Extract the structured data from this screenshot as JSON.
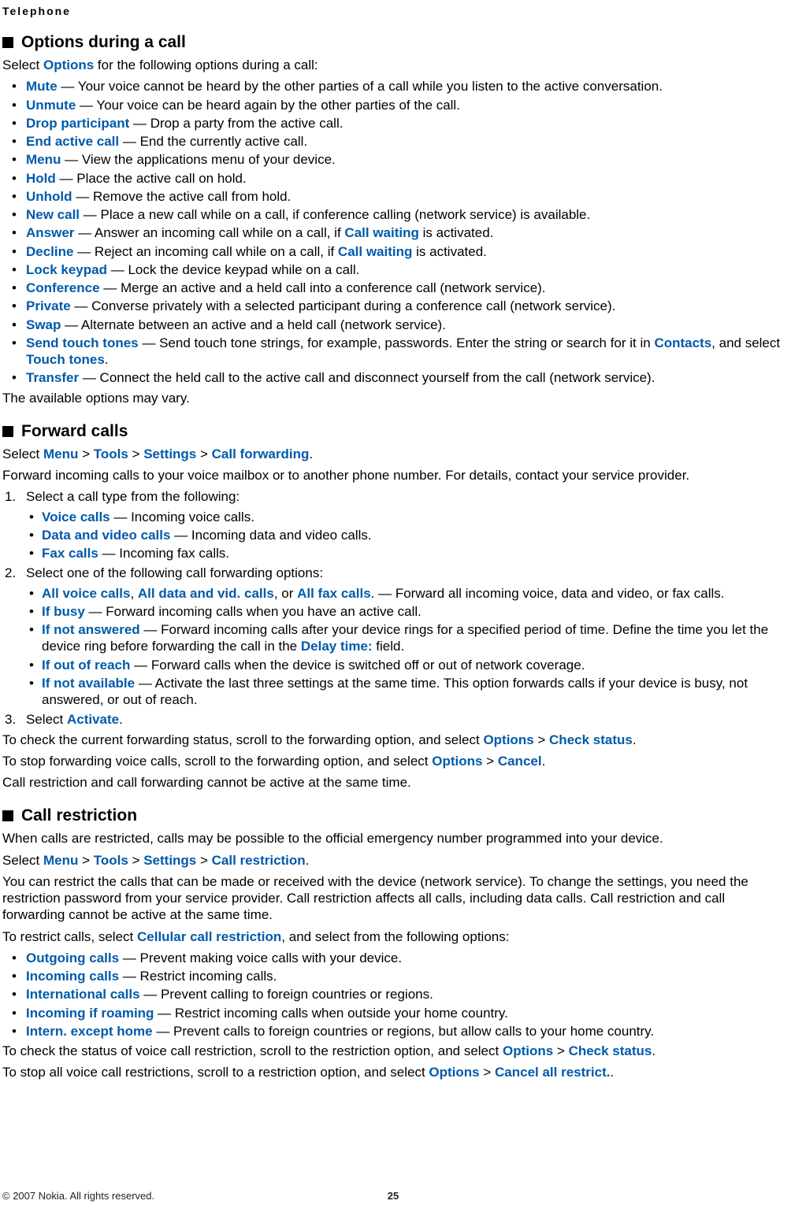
{
  "running_head": "Telephone",
  "s1": {
    "title": "Options during a call",
    "intro_pre": "Select ",
    "intro_key": "Options",
    "intro_post": " for the following options during a call:",
    "items": [
      {
        "key": "Mute",
        "rest": " — Your voice cannot be heard by the other parties of a call while you listen to the active conversation."
      },
      {
        "key": "Unmute",
        "rest": " — Your voice can be heard again by the other parties of the call."
      },
      {
        "key": "Drop participant",
        "rest": " — Drop a party from the active call."
      },
      {
        "key": "End active call",
        "rest": " — End the currently active call."
      },
      {
        "key": "Menu",
        "rest": " — View the applications menu of your device."
      },
      {
        "key": "Hold",
        "rest": " — Place the active call on hold."
      },
      {
        "key": "Unhold",
        "rest": " — Remove the active call from hold."
      },
      {
        "key": "New call",
        "rest": " — Place a new call while on a call, if conference calling (network service) is available."
      },
      {
        "key": "Answer",
        "pre": " — Answer an incoming call while on a call, if ",
        "key2": "Call waiting",
        "post": " is activated."
      },
      {
        "key": "Decline",
        "pre": " — Reject an incoming call while on a call, if ",
        "key2": "Call waiting",
        "post": " is activated."
      },
      {
        "key": "Lock keypad",
        "rest": " — Lock the device keypad while on a call."
      },
      {
        "key": "Conference",
        "rest": " — Merge an active and a held call into a conference call (network service)."
      },
      {
        "key": "Private",
        "rest": " — Converse privately with a selected participant during a conference call (network service)."
      },
      {
        "key": "Swap",
        "rest": " — Alternate between an active and a held call (network service)."
      },
      {
        "key": "Send touch tones",
        "pre": " — Send touch tone strings, for example, passwords. Enter the string or search for it in ",
        "key2": "Contacts",
        "mid": ", and select ",
        "key3": "Touch tones",
        "post": "."
      },
      {
        "key": "Transfer",
        "rest": " — Connect the held call to the active call and disconnect yourself from the call (network service)."
      }
    ],
    "outro": "The available options may vary."
  },
  "s2": {
    "title": "Forward calls",
    "path": [
      "Menu",
      "Tools",
      "Settings",
      "Call forwarding"
    ],
    "path_prefix": "Select ",
    "sep": " > ",
    "path_end": ".",
    "intro": "Forward incoming calls to your voice mailbox or to another phone number. For details, contact your service provider.",
    "step1": "Select a call type from the following:",
    "step1_items": [
      {
        "key": "Voice calls",
        "rest": " — Incoming voice calls."
      },
      {
        "key": "Data and video calls",
        "rest": " — Incoming data and video calls."
      },
      {
        "key": "Fax calls",
        "rest": " — Incoming fax calls."
      }
    ],
    "step2": "Select one of the following call forwarding options:",
    "step2_item1": {
      "k1": "All voice calls",
      "c1": ", ",
      "k2": "All data and vid. calls",
      "c2": ", or ",
      "k3": "All fax calls",
      "c3": ". — Forward all incoming voice, data and video, or fax calls."
    },
    "step2_items_simple": [
      {
        "key": "If busy",
        "rest": " — Forward incoming calls when you have an active call."
      }
    ],
    "step2_item_delay": {
      "key": "If not answered",
      "pre": " — Forward incoming calls after your device rings for a specified period of time. Define the time you let the device ring before forwarding the call in the ",
      "key2": "Delay time:",
      "post": " field."
    },
    "step2_items_simple2": [
      {
        "key": "If out of reach",
        "rest": " —  Forward calls when the device is switched off or out of network coverage."
      },
      {
        "key": "If not available",
        "rest": " — Activate the last three settings at the same time. This option forwards calls if your device is busy, not answered, or out of reach."
      }
    ],
    "step3_pre": "Select ",
    "step3_key": "Activate",
    "step3_post": ".",
    "status_line": {
      "pre": "To check the current forwarding status, scroll to the forwarding option, and select ",
      "k1": "Options",
      "sep": " > ",
      "k2": "Check status",
      "post": "."
    },
    "cancel_line": {
      "pre": "To stop forwarding voice calls, scroll to the forwarding option, and select ",
      "k1": "Options",
      "sep": " > ",
      "k2": "Cancel",
      "post": "."
    },
    "tail": "Call restriction and call forwarding cannot be active at the same time."
  },
  "s3": {
    "title": "Call restriction",
    "intro": "When calls are restricted, calls may be possible to the official emergency number programmed into your device.",
    "path_prefix": "Select ",
    "path": [
      "Menu",
      "Tools",
      "Settings",
      "Call restriction"
    ],
    "sep": " > ",
    "path_end": ".",
    "desc": "You can restrict the calls that can be made or received with the device (network service). To change the settings, you need the restriction password from your service provider. Call restriction affects all calls, including data calls. Call restriction and call forwarding cannot be active at the same time.",
    "lead_pre": "To restrict calls, select ",
    "lead_key": "Cellular call restriction",
    "lead_post": ", and select from the following options:",
    "items": [
      {
        "key": "Outgoing calls",
        "rest": " — Prevent making voice calls with your device."
      },
      {
        "key": "Incoming calls",
        "rest": " — Restrict incoming calls."
      },
      {
        "key": "International calls",
        "rest": " — Prevent calling to foreign countries or regions."
      },
      {
        "key": "Incoming if roaming",
        "rest": " — Restrict incoming calls when outside your home country."
      },
      {
        "key": "Intern. except home",
        "rest": " — Prevent calls to foreign countries or regions, but allow calls to your home country."
      }
    ],
    "status_line": {
      "pre": "To check the status of voice call restriction, scroll to the restriction option, and select ",
      "k1": "Options",
      "sep": " > ",
      "k2": "Check status",
      "post": "."
    },
    "cancel_line": {
      "pre": "To stop all voice call restrictions, scroll to a restriction option, and select ",
      "k1": "Options",
      "sep": " > ",
      "k2": "Cancel all restrict.",
      "post": "."
    }
  },
  "footer": {
    "copyright": "© 2007 Nokia. All rights reserved.",
    "page": "25"
  }
}
